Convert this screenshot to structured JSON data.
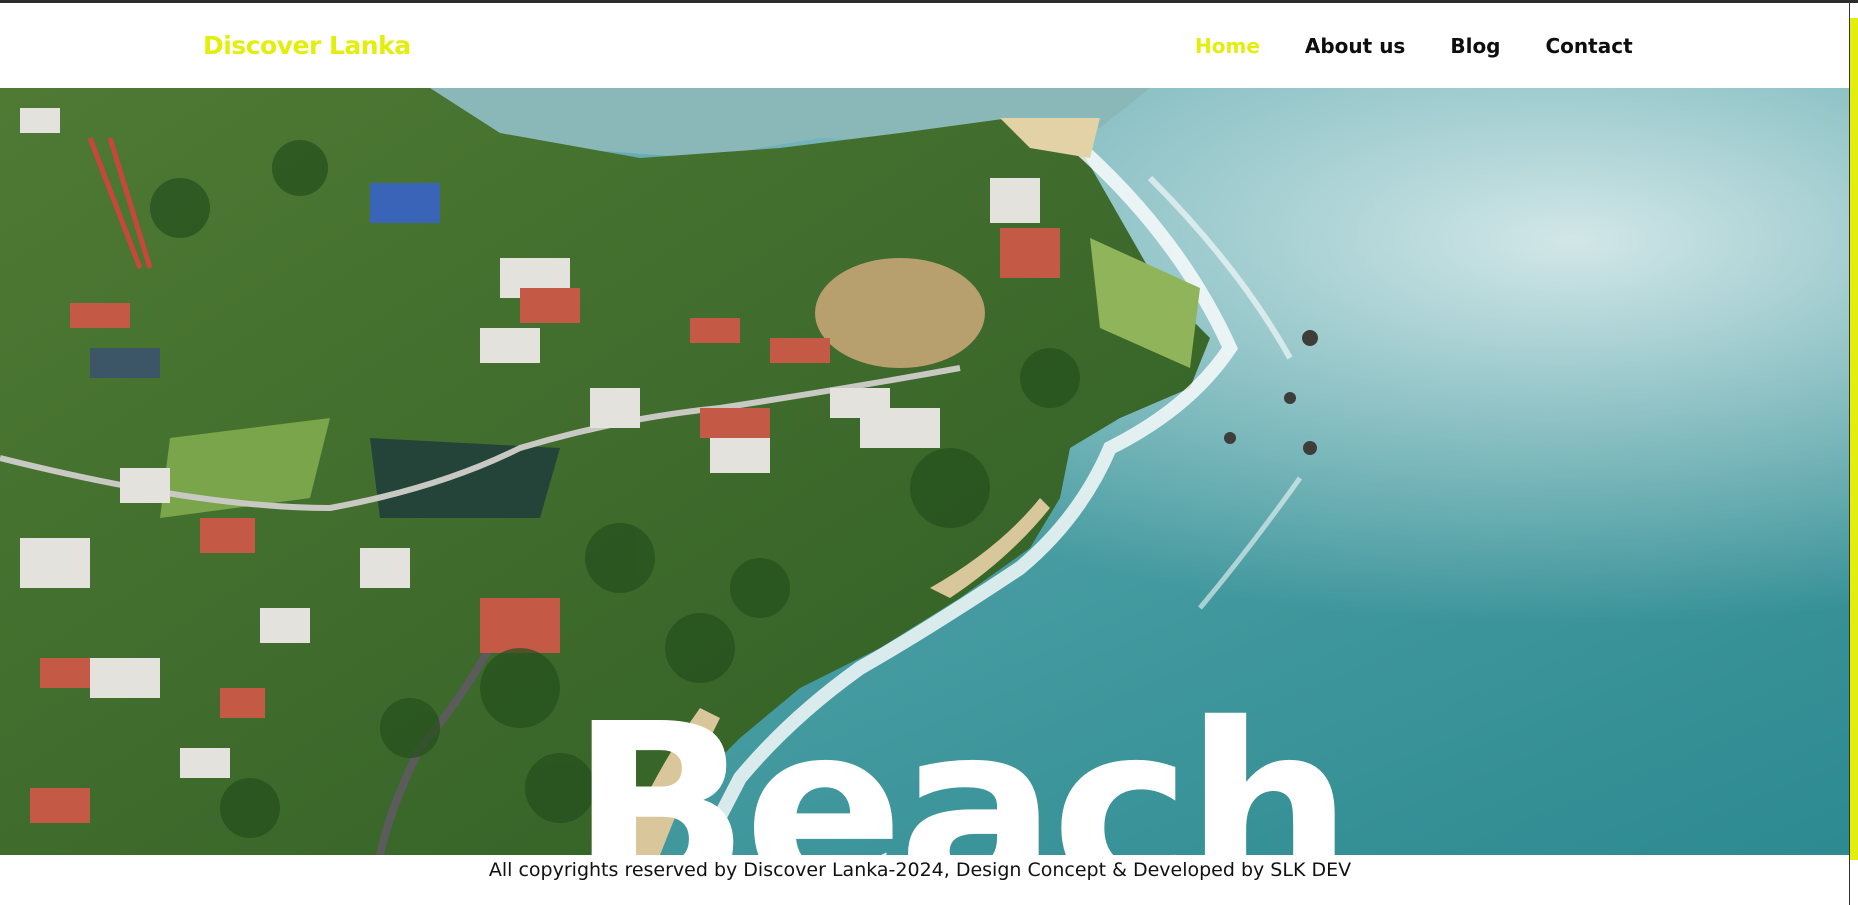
{
  "header": {
    "brand": "Discover Lanka",
    "nav": [
      {
        "label": "Home",
        "active": true
      },
      {
        "label": "About us",
        "active": false
      },
      {
        "label": "Blog",
        "active": false
      },
      {
        "label": "Contact",
        "active": false
      }
    ]
  },
  "hero": {
    "title": "Beach",
    "image_description_icon": "aerial-coastline-image"
  },
  "footer": {
    "copyright": "All copyrights reserved by Discover Lanka-2024, Design Concept & Developed by SLK DEV"
  },
  "colors": {
    "accent": "#e3ee0c",
    "nav_text": "#0e0e0e",
    "sea": "#3a8f92",
    "land": "#3d6a2c"
  }
}
